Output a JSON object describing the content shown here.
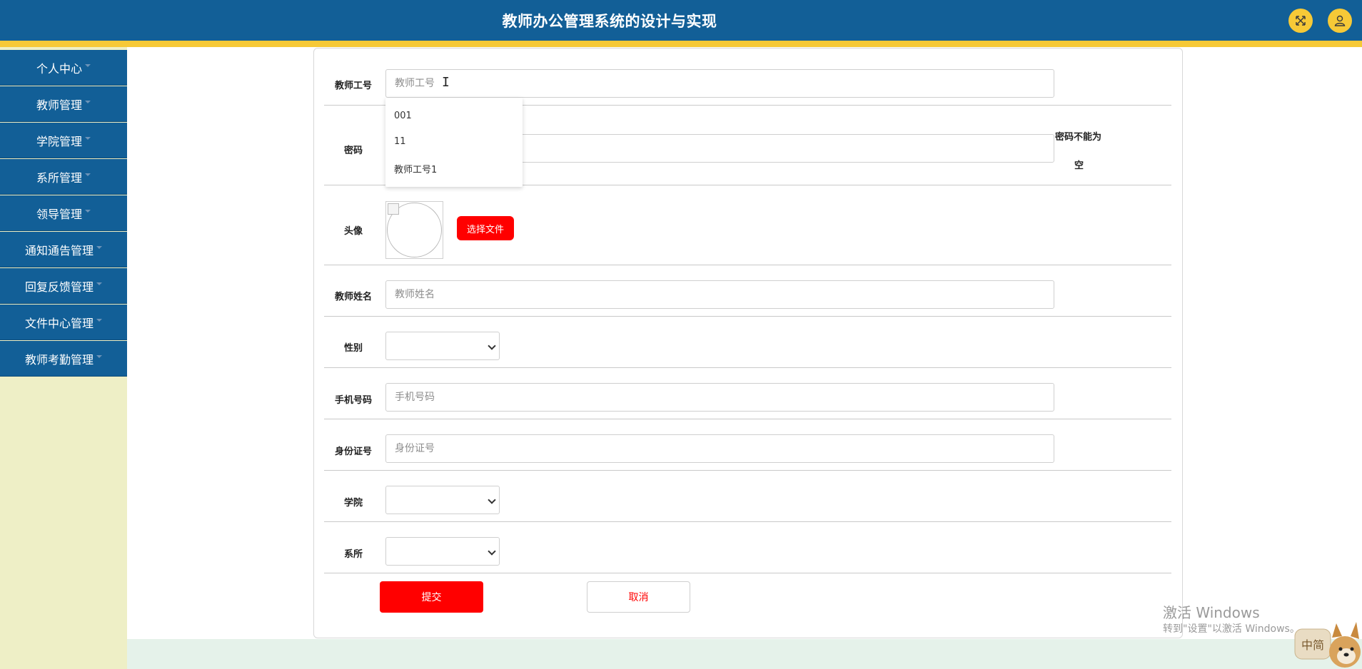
{
  "header": {
    "title": "教师办公管理系统的设计与实现",
    "fullscreen_icon": "expand-icon",
    "user_icon": "user-icon",
    "colors": {
      "bar": "#125f97",
      "stripe": "#f6c937"
    }
  },
  "sidebar": {
    "items": [
      {
        "label": "个人中心"
      },
      {
        "label": "教师管理"
      },
      {
        "label": "学院管理"
      },
      {
        "label": "系所管理"
      },
      {
        "label": "领导管理"
      },
      {
        "label": "通知通告管理"
      },
      {
        "label": "回复反馈管理"
      },
      {
        "label": "文件中心管理"
      },
      {
        "label": "教师考勤管理"
      }
    ]
  },
  "form": {
    "teacher_id": {
      "label": "教师工号",
      "placeholder": "教师工号",
      "value": ""
    },
    "autocomplete": [
      "001",
      "11",
      "教师工号1"
    ],
    "password": {
      "label": "密码",
      "error_line1": "密码不能为",
      "error_line2": "空"
    },
    "avatar": {
      "label": "头像",
      "button": "选择文件"
    },
    "name": {
      "label": "教师姓名",
      "placeholder": "教师姓名"
    },
    "gender": {
      "label": "性别",
      "value": ""
    },
    "phone": {
      "label": "手机号码",
      "placeholder": "手机号码"
    },
    "id_card": {
      "label": "身份证号",
      "placeholder": "身份证号"
    },
    "college": {
      "label": "学院",
      "value": ""
    },
    "department": {
      "label": "系所",
      "value": ""
    },
    "submit": "提交",
    "cancel": "取消"
  },
  "watermark": {
    "line1": "激活 Windows",
    "line2": "转到\"设置\"以激活 Windows。",
    "mascot_text": "中简"
  }
}
